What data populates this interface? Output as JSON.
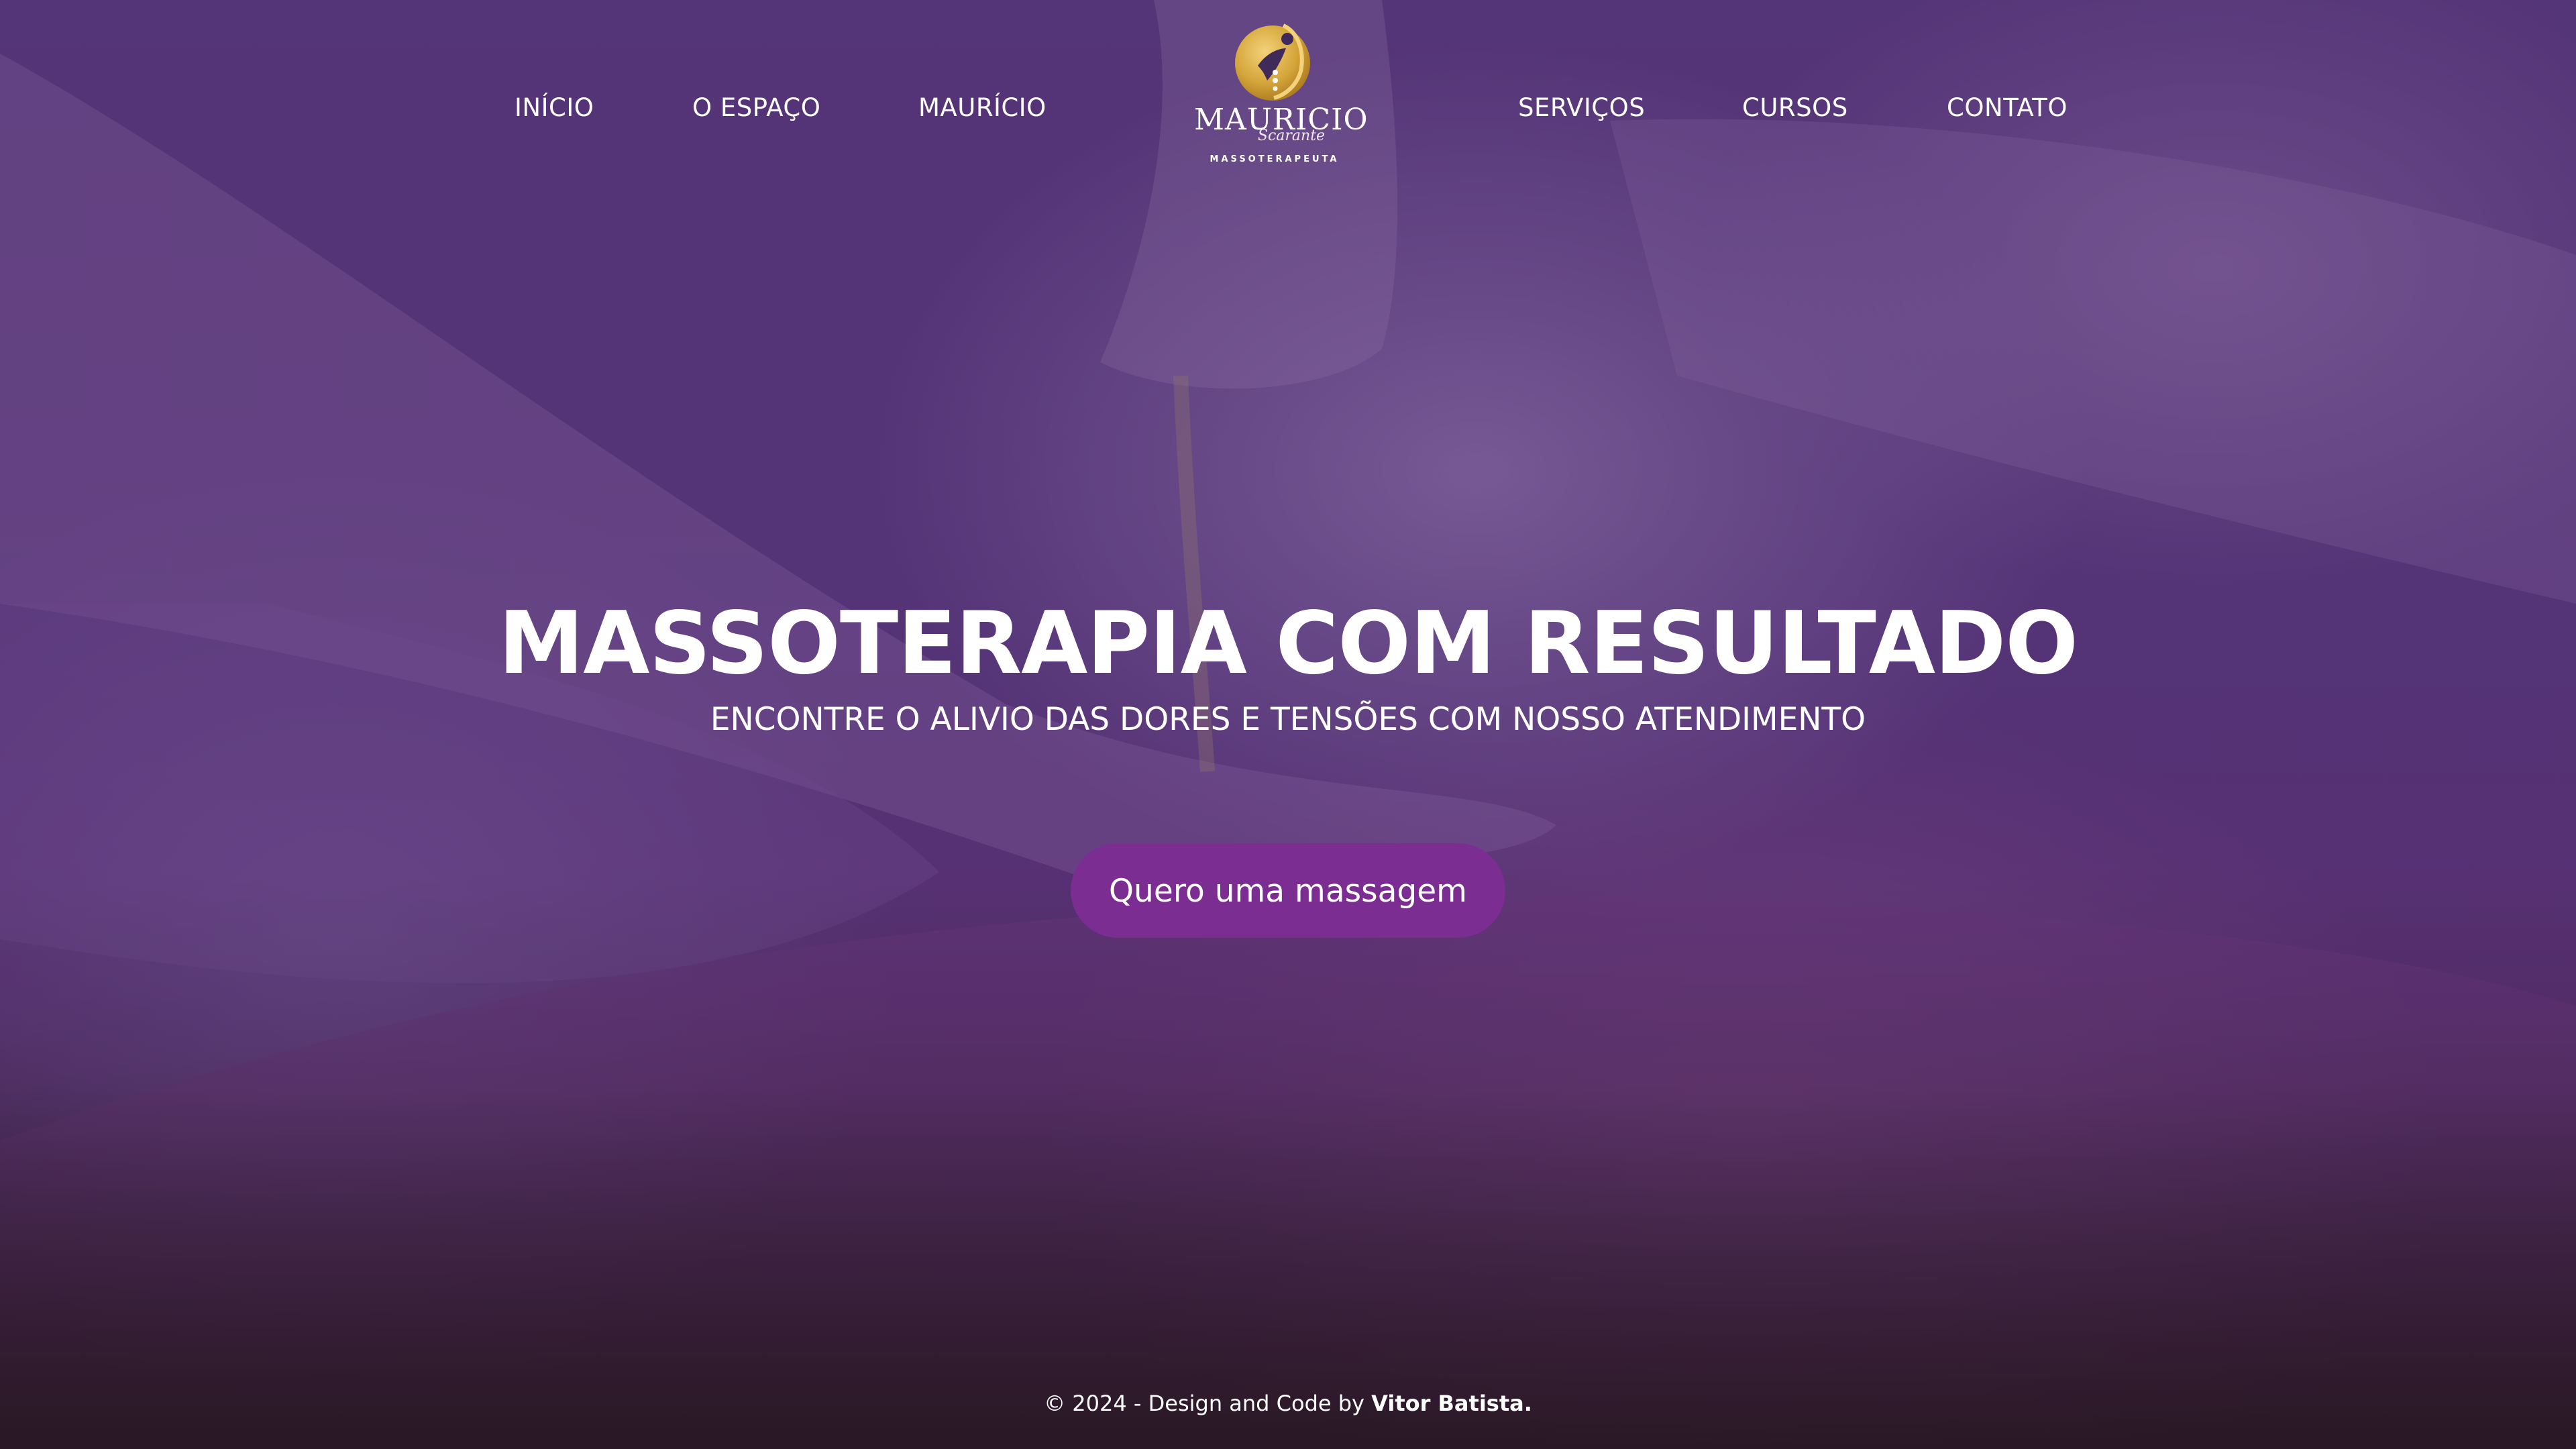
{
  "colors": {
    "overlay_purple": "#4a2f66",
    "button_bg": "#7b2d91",
    "logo_gold": "#d4a53a",
    "text": "#ffffff"
  },
  "nav": {
    "items": [
      {
        "label": "INÍCIO"
      },
      {
        "label": "O ESPAÇO"
      },
      {
        "label": "MAURÍCIO"
      },
      {
        "label": "SERVIÇOS"
      },
      {
        "label": "CURSOS"
      },
      {
        "label": "CONTATO"
      }
    ]
  },
  "logo": {
    "name": "MAURICIO",
    "surname": "Scarante",
    "subtitle": "MASSOTERAPEUTA",
    "icon": "gold-circle-figure-icon"
  },
  "hero": {
    "title": "MASSOTERAPIA COM RESULTADO",
    "subtitle": "ENCONTRE O ALIVIO DAS DORES E TENSÕES COM NOSSO ATENDIMENTO",
    "cta_label": "Quero uma massagem"
  },
  "footer": {
    "prefix": "© 2024 - Design and Code by ",
    "author": "Vitor Batista."
  }
}
